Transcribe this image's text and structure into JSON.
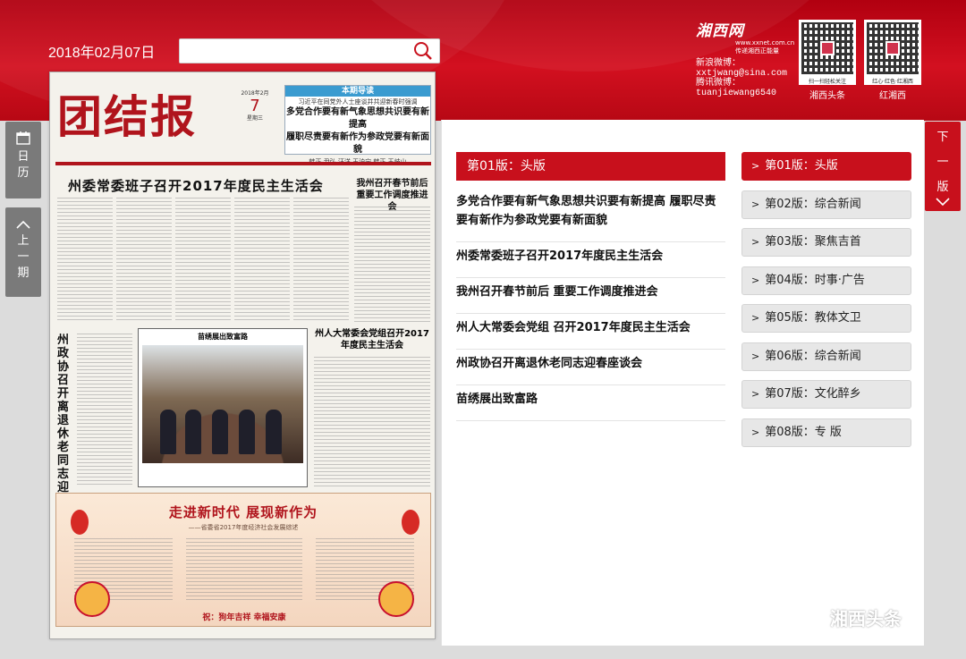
{
  "header": {
    "date": "2018年02月07日",
    "search": {
      "placeholder": ""
    }
  },
  "brand": {
    "logo": "湘西网",
    "url": "www.xxnet.com.cn",
    "slogan": "传递湘西正能量",
    "sina_label": "新浪微博：",
    "sina_value": "xxtjwang@sina.com",
    "tencent_label": "腾讯微博：",
    "tencent_value": "tuanjiewang6540"
  },
  "qrcodes": [
    {
      "label": "湘西头条",
      "caption": "扫一扫轻松关注"
    },
    {
      "label": "红湘西",
      "caption": "红心·红色·红湘西"
    }
  ],
  "nav": {
    "calendar": [
      "日",
      "历"
    ],
    "prev": [
      "上",
      "一",
      "期"
    ],
    "next": [
      "下",
      "一",
      "版"
    ]
  },
  "newspaper": {
    "masthead": "团结报",
    "day_number": "7",
    "date_line": "2018年2月",
    "weekday": "星期三",
    "guide_title": "本期导读",
    "guide_sub": "习近平在同党外人士座谈并共迎新春时强调",
    "guide_headline_1": "多党合作要有新气象思想共识要有新提高",
    "guide_headline_2": "履职尽责要有新作为参政党要有新面貌",
    "guide_note": "韩正 尹弘 汪洋 王沪宁 韩正 王岐山",
    "headline_main": "州委常委班子召开2017年度民主生活会",
    "headline_side": "我州召开春节前后重要工作调度推进会",
    "vertical_headline": "州政协召开离退休老同志迎春座谈会",
    "photo_caption": "苗绣展出致富路",
    "headline_npc": "州人大常委会党组召开2017年度民主生活会",
    "banner_title": "走进新时代 展现新作为",
    "banner_sub": "——省委省2017年度经济社会发展综述",
    "banner_footer": "祝：狗年吉祥  幸福安康"
  },
  "section": {
    "title": "第01版：头版",
    "headlines": [
      "多党合作要有新气象思想共识要有新提高 履职尽责要有新作为参政党要有新面貌",
      "州委常委班子召开2017年度民主生活会",
      "我州召开春节前后 重要工作调度推进会",
      "州人大常委会党组 召开2017年度民主生活会",
      "州政协召开离退休老同志迎春座谈会",
      "苗绣展出致富路"
    ]
  },
  "pages": [
    "第01版：头版",
    "第02版：综合新闻",
    "第03版：聚焦吉首",
    "第04版：时事·广告",
    "第05版：教体文卫",
    "第06版：综合新闻",
    "第07版：文化醉乡",
    "第08版：专 版"
  ],
  "watermark": "湘西头条",
  "colors": {
    "accent": "#c8101c",
    "banner_red": "#b70814",
    "inactive_tab": "#e7e7e7",
    "side_tab": "#7a7a7a"
  }
}
